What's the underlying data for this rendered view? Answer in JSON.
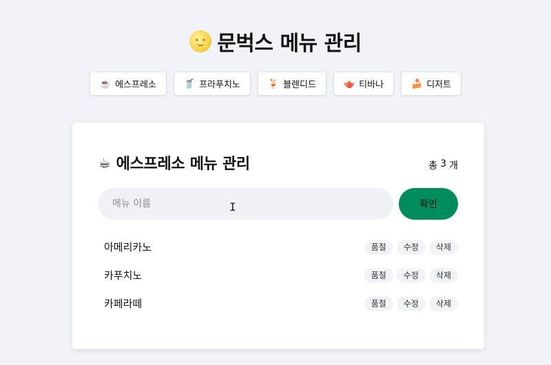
{
  "header": {
    "title": "문벅스 메뉴 관리",
    "icon": "moon-face-icon"
  },
  "nav": [
    {
      "label": "에스프레소",
      "icon": "☕",
      "icon_name": "coffee-icon"
    },
    {
      "label": "프라푸치노",
      "icon": "🥤",
      "icon_name": "frappuccino-icon"
    },
    {
      "label": "블렌디드",
      "icon": "🍹",
      "icon_name": "blended-icon"
    },
    {
      "label": "티바나",
      "icon": "🫖",
      "icon_name": "tea-icon"
    },
    {
      "label": "디저트",
      "icon": "🍰",
      "icon_name": "cake-icon"
    }
  ],
  "card": {
    "title": "에스프레소 메뉴 관리",
    "title_icon": "☕",
    "count_prefix": "총",
    "count": "3",
    "count_suffix": "개",
    "input_placeholder": "메뉴 이름",
    "input_value": "",
    "confirm_label": "확인"
  },
  "menu_items": [
    {
      "name": "아메리카노",
      "soldout": "품절",
      "edit": "수정",
      "delete": "삭제"
    },
    {
      "name": "카푸치노",
      "soldout": "품절",
      "edit": "수정",
      "delete": "삭제"
    },
    {
      "name": "카페라떼",
      "soldout": "품절",
      "edit": "수정",
      "delete": "삭제"
    }
  ],
  "colors": {
    "background": "#f0f3f7",
    "confirm_button": "#008d5e",
    "pill": "#f0f3f7"
  }
}
